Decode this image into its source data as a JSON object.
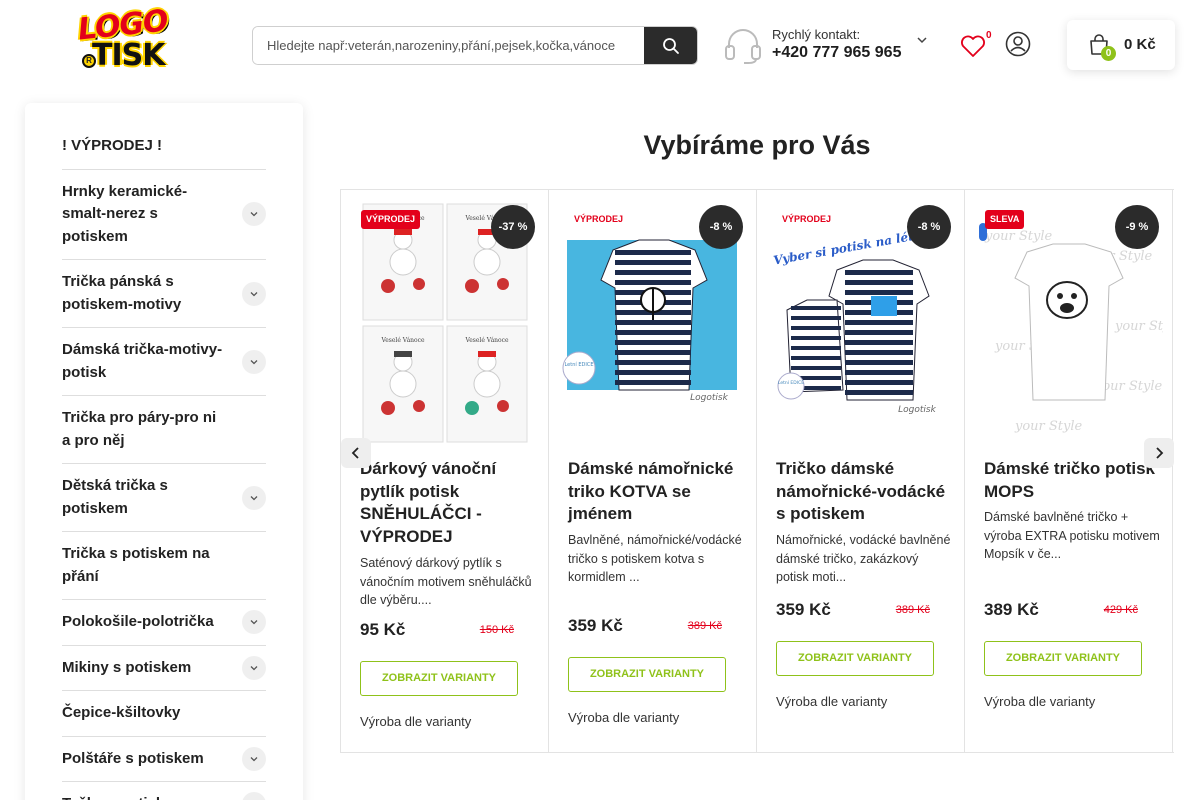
{
  "header": {
    "logo": {
      "top": "LOGO",
      "bottom": "TISK",
      "mark": "R"
    },
    "search": {
      "placeholder": "Hledejte např:veterán,narozeniny,přání,pejsek,kočka,vánoce"
    },
    "contact": {
      "label": "Rychlý kontakt:",
      "phone": "+420 777 965 965"
    },
    "wishlist": {
      "count": "0"
    },
    "cart": {
      "count": "0",
      "total": "0 Kč"
    }
  },
  "sidebar": {
    "items": [
      {
        "label": "! VÝPRODEJ !",
        "has_children": false
      },
      {
        "label": "Hrnky keramické-smalt-nerez s potiskem",
        "has_children": true
      },
      {
        "label": "Trička pánská s potiskem-motivy",
        "has_children": true
      },
      {
        "label": "Dámská trička-motivy-potisk",
        "has_children": true
      },
      {
        "label": "Trička pro páry-pro ni a pro něj",
        "has_children": false
      },
      {
        "label": "Dětská trička s potiskem",
        "has_children": true
      },
      {
        "label": "Trička s potiskem na přání",
        "has_children": false
      },
      {
        "label": "Polokošile-polotrička",
        "has_children": true
      },
      {
        "label": "Mikiny s potiskem",
        "has_children": true
      },
      {
        "label": "Čepice-kšiltovky",
        "has_children": false
      },
      {
        "label": "Polštáře s potiskem",
        "has_children": true
      },
      {
        "label": "Tašky s potiskem",
        "has_children": true
      }
    ]
  },
  "main": {
    "title": "Vybíráme pro Vás",
    "products": [
      {
        "flag": "VÝPRODEJ",
        "discount": "-37 %",
        "title": "Dárkový vánoční pytlík potisk SNĚHULÁČCI - VÝPRODEJ",
        "description": "Saténový dárkový pytlík s vánočním motivem sněhuláčků dle výběru....",
        "price": "95 Kč",
        "old_price": "150 Kč",
        "button": "ZOBRAZIT VARIANTY",
        "availability": "Výroba dle varianty",
        "image_text": "Veselé Vánoce"
      },
      {
        "flag": "VÝPRODEJ",
        "discount": "-8 %",
        "title": "Dámské námořnické triko KOTVA se jménem",
        "description": "Bavlněné, námořnické/vodácké tričko s potiskem kotva s kormidlem ...",
        "price": "359 Kč",
        "old_price": "389 Kč",
        "button": "ZOBRAZIT VARIANTY",
        "availability": "Výroba dle varianty",
        "image_text": "Logotisk",
        "badge_text": "Letní EDICE"
      },
      {
        "flag": "VÝPRODEJ",
        "discount": "-8 %",
        "title": "Tričko dámské námořnické-vodácké s potiskem",
        "description": "Námořnické, vodácké bavlněné dámské tričko, zakázkový potisk moti...",
        "price": "359 Kč",
        "old_price": "389 Kč",
        "button": "ZOBRAZIT VARIANTY",
        "availability": "Výroba dle varianty",
        "image_text": "Vyber si potisk na léto.",
        "image_text2": "Logotisk",
        "badge_text": "Letní EDICE"
      },
      {
        "flag": "SLEVA",
        "discount": "-9 %",
        "title": "Dámské tričko potisk MOPS",
        "description": "Dámské bavlněné tričko + výroba EXTRA potisku motivem Mopsík v če...",
        "price": "389 Kč",
        "old_price": "429 Kč",
        "button": "ZOBRAZIT VARIANTY",
        "availability": "Výroba dle varianty",
        "image_text": "your Style"
      }
    ]
  },
  "colors": {
    "accent_green": "#8fc21a",
    "sale_red": "#e3001b",
    "dark": "#2b2b2b"
  },
  "icons": [
    "search-icon",
    "headset-icon",
    "chevron-down-icon",
    "heart-icon",
    "user-icon",
    "cart-icon",
    "chevron-left-icon",
    "chevron-right-icon"
  ]
}
